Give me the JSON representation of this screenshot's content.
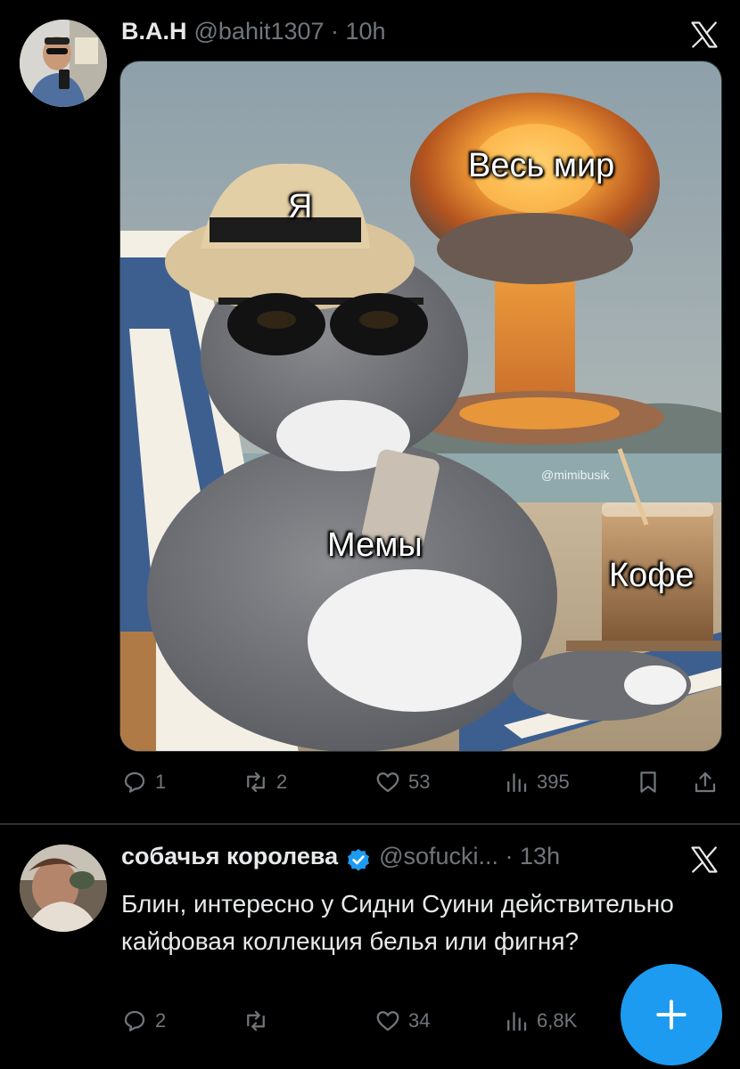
{
  "tweets": [
    {
      "display_name": "В.А.Н",
      "handle_time": "@bahit1307 · 10h",
      "media": {
        "labels": {
          "me": "Я",
          "world": "Весь мир",
          "memes": "Мемы",
          "coffee": "Кофе"
        },
        "watermark": "@mimibusik"
      },
      "stats": {
        "replies": "1",
        "reposts": "2",
        "likes": "53",
        "views": "395"
      }
    },
    {
      "display_name": "собачья королева",
      "handle_time": "@sofucki... · 13h",
      "text": "Блин, интересно у Сидни Суини действительно кайфовая коллекция белья или фигня?",
      "stats": {
        "replies": "2",
        "likes": "34",
        "views": "6,8K"
      }
    }
  ],
  "icons": {
    "reply": "speech-bubble-icon",
    "repost": "repost-arrows-icon",
    "like": "heart-icon",
    "views": "bar-chart-icon",
    "bookmark": "bookmark-icon",
    "share": "share-upload-icon",
    "verified": "verified-badge-icon",
    "x": "x-logo-icon",
    "compose": "plus-icon"
  },
  "colors": {
    "background": "#000000",
    "text": "#e7e9ea",
    "muted": "#71767b",
    "accent": "#1d9bf0",
    "divider": "#2f3336"
  }
}
